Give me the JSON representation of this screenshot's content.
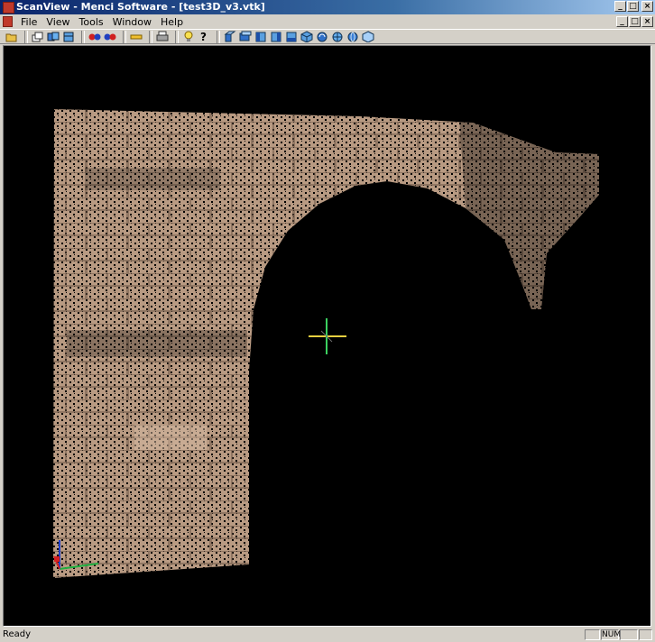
{
  "window": {
    "title": "ScanView - Menci Software - [test3D_v3.vtk]",
    "controls": {
      "minimize": "_",
      "maximize": "□",
      "close": "×"
    }
  },
  "menu": {
    "items": [
      "File",
      "View",
      "Tools",
      "Window",
      "Help"
    ]
  },
  "toolbar": {
    "icons": [
      "open-icon",
      "layers-icon",
      "cube-copy-icon",
      "red-blue-spheres-icon",
      "red-blue-spheres-icon",
      "ruler-icon",
      "print-icon",
      "lightbulb-icon",
      "help-icon",
      "view-front-icon",
      "view-top-icon",
      "view-left-icon",
      "view-right-icon",
      "view-bottom-icon",
      "view-iso-icon",
      "rotate-icon",
      "sphere-icon",
      "globe-icon",
      "cube-icon"
    ]
  },
  "viewport": {
    "background": "#000000",
    "scene": "point cloud of stone arch"
  },
  "status": {
    "text": "Ready",
    "num": "NUM"
  },
  "colors": {
    "title_start": "#0a246a",
    "title_end": "#a6caf0",
    "chrome": "#d4d0c8",
    "stone": "#b89a82",
    "axis_x": "#d62020",
    "axis_y": "#20b040",
    "axis_z": "#2040d0",
    "cross_h": "#e8d040",
    "cross_v": "#3bd060"
  }
}
